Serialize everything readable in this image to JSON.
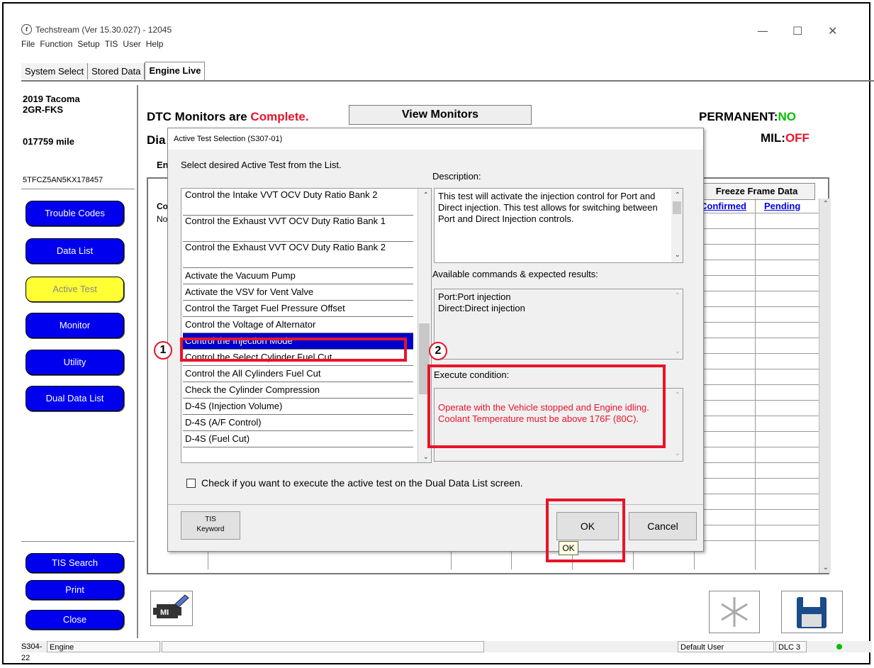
{
  "window": {
    "title": "Techstream (Ver 15.30.027) - 12045",
    "controls": [
      "—",
      "☐",
      "✕"
    ]
  },
  "menu": [
    "File",
    "Function",
    "Setup",
    "TIS",
    "User",
    "Help"
  ],
  "tabs": [
    {
      "label": "System Select",
      "active": false
    },
    {
      "label": "Stored Data",
      "active": false
    },
    {
      "label": "Engine Live",
      "active": true
    }
  ],
  "vehicle": {
    "model": "2019 Tacoma",
    "engine": "2GR-FKS",
    "mileage": "017759 mile",
    "vin": "5TFCZ5AN5KX178457"
  },
  "nav": {
    "trouble_codes": "Trouble Codes",
    "data_list": "Data List",
    "active_test": "Active Test",
    "monitor": "Monitor",
    "utility": "Utility",
    "dual_data_list": "Dual Data List",
    "tis_search": "TIS Search",
    "print": "Print",
    "close": "Close"
  },
  "header": {
    "dtc_label": "DTC Monitors are",
    "dtc_status": "Complete.",
    "view_monitors": "View Monitors",
    "permanent_label": "PERMANENT:",
    "permanent_value": "NO",
    "mil_label": "MIL:",
    "mil_value": "OFF",
    "dia_partial": "Dia",
    "en_partial": "En",
    "co_partial": "Co",
    "no_partial": "No"
  },
  "freeze_frame": {
    "title": "Freeze Frame Data",
    "confirmed": "Confirmed",
    "pending": "Pending"
  },
  "dialog": {
    "title": "Active Test Selection (S307-01)",
    "instruction": "Select desired Active Test from the List.",
    "tests": [
      "Control the Intake VVT OCV Duty Ratio Bank 2",
      "Control the Exhaust VVT OCV Duty Ratio Bank 1",
      "Control the Exhaust VVT OCV Duty Ratio Bank 2",
      "Activate the Vacuum Pump",
      "Activate the VSV for Vent Valve",
      "Control the Target Fuel Pressure Offset",
      "Control the Voltage of Alternator",
      "Control the Injection Mode",
      "Control the Select Cylinder Fuel Cut",
      "Control the All Cylinders Fuel Cut",
      "Check the Cylinder Compression",
      "D-4S (Injection Volume)",
      "D-4S (A/F Control)",
      "D-4S (Fuel Cut)"
    ],
    "selected_index": 7,
    "description_label": "Description:",
    "description": "This test will activate the injection control for Port and Direct injection. This test allows for switching between Port and Direct Injection controls.",
    "commands_label": "Available commands & expected results:",
    "commands": [
      "Port:Port injection",
      "Direct:Direct injection"
    ],
    "condition_label": "Execute condition:",
    "condition": "Operate with the Vehicle stopped and Engine idling.\nCoolant Temperature must be above 176F (80C).",
    "checkbox_label": "Check if you want to execute the active test on the Dual Data List screen.",
    "tis_keyword": "TIS\nKeyword",
    "ok": "OK",
    "cancel": "Cancel",
    "ok_tooltip": "OK"
  },
  "callouts": [
    "1",
    "2"
  ],
  "status_bar": {
    "code": "S304-22",
    "system": "Engine",
    "user": "Default User",
    "dlc": "DLC 3"
  },
  "colors": {
    "nav_blue": "#0000ee",
    "active_yellow": "#ffff33",
    "status_red": "#e8132a",
    "status_green": "#00c000",
    "highlight_red": "#e8132a"
  },
  "icons": [
    "techstream-logo-icon",
    "mil-engine-icon",
    "snowflake-icon",
    "save-floppy-icon",
    "chevron-up-icon",
    "chevron-down-icon",
    "dlc-status-dot-icon"
  ]
}
